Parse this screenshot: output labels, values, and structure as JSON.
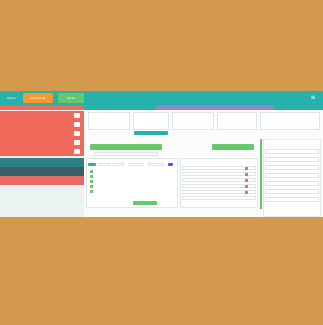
{
  "topbar": {
    "tabs": [
      {
        "label": "Home"
      },
      {
        "label": "Leads List"
      },
      {
        "label": "Tasks"
      }
    ],
    "menu_icon": "hamburger-icon"
  },
  "left_panel": {
    "header": "",
    "rows": [
      {
        "label": "",
        "count": ""
      },
      {
        "label": "",
        "count": ""
      },
      {
        "label": "",
        "count": ""
      },
      {
        "label": "",
        "count": ""
      },
      {
        "label": "",
        "count": ""
      },
      {
        "label": "",
        "count": ""
      },
      {
        "label": "",
        "count": ""
      },
      {
        "label": "",
        "count": ""
      }
    ]
  },
  "colors": {
    "background": "#d39a4e",
    "topbar": "#26b1aa",
    "tab_active": "#f29b32",
    "tab_secondary": "#65c86a",
    "accent_purple": "#8f86c9",
    "accent_red": "#f06a5b"
  }
}
